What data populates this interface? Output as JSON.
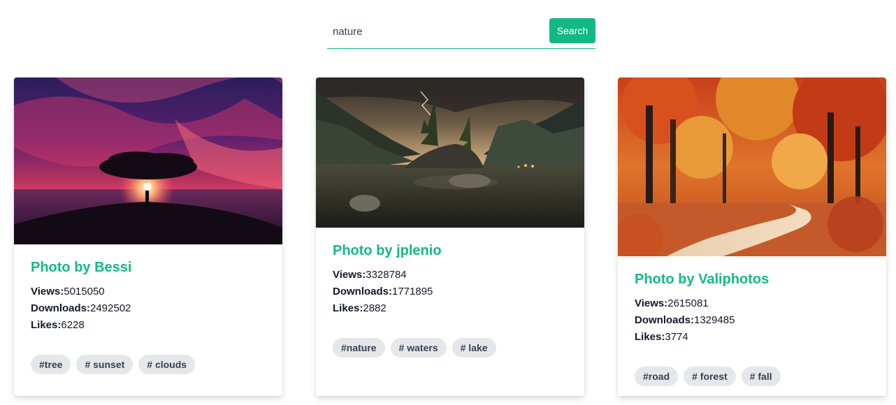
{
  "search": {
    "value": "nature",
    "button_label": "Search"
  },
  "colors": {
    "accent": "#14b886",
    "tag_bg": "#e5e7eb"
  },
  "cards": [
    {
      "title": "Photo by Bessi",
      "image_icon": "sunset-tree-photo",
      "views_label": "Views:",
      "views": "5015050",
      "downloads_label": "Downloads:",
      "downloads": "2492502",
      "likes_label": "Likes:",
      "likes": "6228",
      "tags": [
        "#tree",
        "# sunset",
        "# clouds"
      ]
    },
    {
      "title": "Photo by jplenio",
      "image_icon": "lake-mountains-photo",
      "views_label": "Views:",
      "views": "3328784",
      "downloads_label": "Downloads:",
      "downloads": "1771895",
      "likes_label": "Likes:",
      "likes": "2882",
      "tags": [
        "#nature",
        "# waters",
        "# lake"
      ]
    },
    {
      "title": "Photo by Valiphotos",
      "image_icon": "autumn-road-photo",
      "views_label": "Views:",
      "views": "2615081",
      "downloads_label": "Downloads:",
      "downloads": "1329485",
      "likes_label": "Likes:",
      "likes": "3774",
      "tags": [
        "#road",
        "# forest",
        "# fall"
      ]
    }
  ]
}
